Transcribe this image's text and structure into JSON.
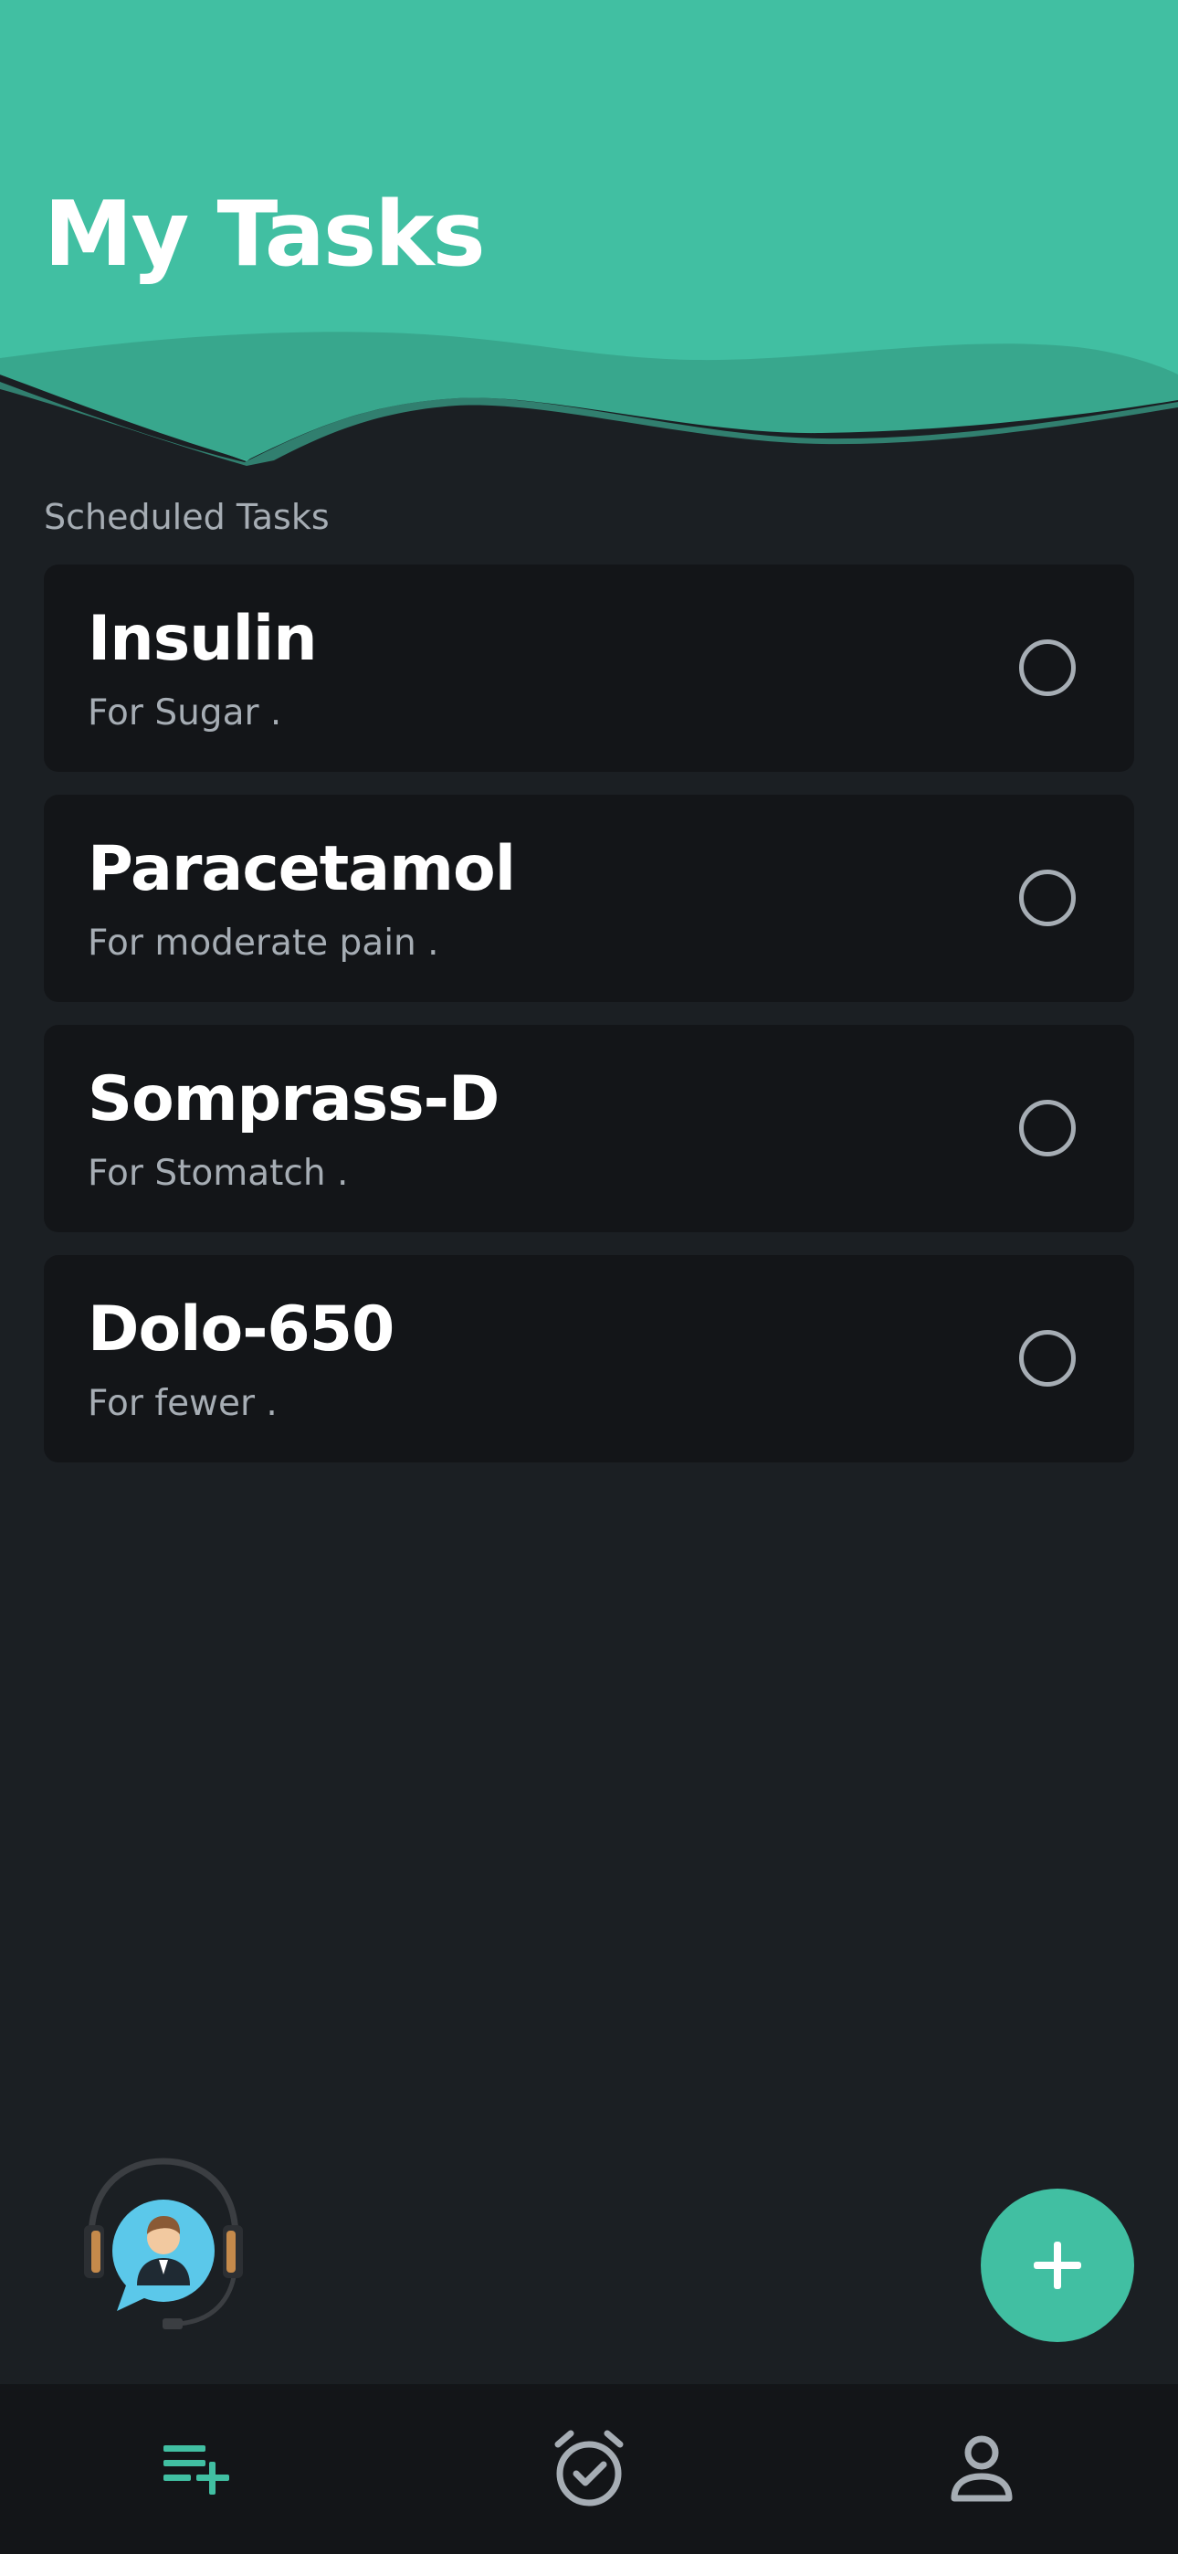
{
  "header": {
    "title": "My Tasks"
  },
  "section": {
    "label": "Scheduled Tasks"
  },
  "tasks": [
    {
      "name": "Insulin",
      "description": "For Sugar  .",
      "done": false
    },
    {
      "name": "Paracetamol",
      "description": "For moderate pain  .",
      "done": false
    },
    {
      "name": "Somprass-D",
      "description": "For Stomatch   .",
      "done": false
    },
    {
      "name": "Dolo-650",
      "description": "For fewer  .",
      "done": false
    }
  ],
  "icons": {
    "support": "support-agent-icon",
    "add": "plus-icon",
    "nav_tasks": "playlist-add-icon",
    "nav_alarm": "alarm-check-icon",
    "nav_profile": "person-icon"
  },
  "colors": {
    "accent": "#41bfa2",
    "background": "#1b1f23",
    "card": "#131518",
    "muted_text": "#a6adb4"
  }
}
